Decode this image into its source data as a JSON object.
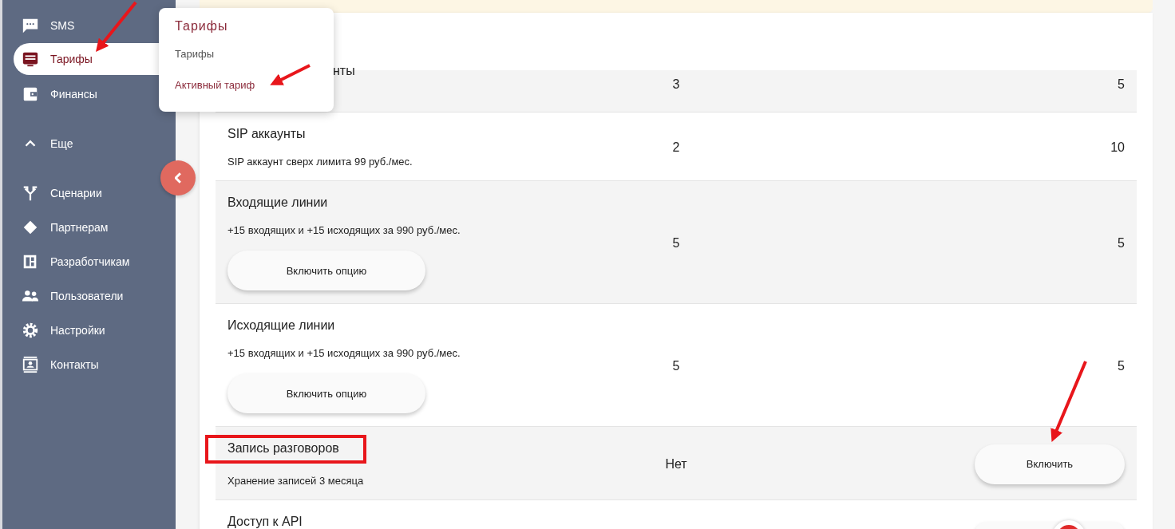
{
  "sidebar": {
    "items": [
      {
        "label": "SMS",
        "selected": false
      },
      {
        "label": "Тарифы",
        "selected": true
      },
      {
        "label": "Финансы",
        "selected": false
      },
      {
        "label": "Еще",
        "selected": false,
        "kind": "toggle"
      },
      {
        "label": "Сценарии",
        "selected": false
      },
      {
        "label": "Партнерам",
        "selected": false
      },
      {
        "label": "Разработчикам",
        "selected": false
      },
      {
        "label": "Пользователи",
        "selected": false
      },
      {
        "label": "Настройки",
        "selected": false
      },
      {
        "label": "Контакты",
        "selected": false
      }
    ]
  },
  "popup_menu": {
    "title": "Тарифы",
    "items": [
      {
        "label": "Тарифы",
        "selected": false
      },
      {
        "label": "Активный тариф",
        "selected": true
      }
    ]
  },
  "table": {
    "rows": [
      {
        "kind": "cut",
        "title": "нты",
        "column_2": "3",
        "column_3": "5"
      },
      {
        "title": "SIP аккаунты",
        "note": "SIP аккаунт сверх лимита 99 руб./мес.",
        "column_2": "2",
        "column_3": "10"
      },
      {
        "title": "Входящие линии",
        "note": "+15 входящих и +15 исходящих за 990 руб./мес.",
        "button": "Включить опцию",
        "column_2": "5",
        "column_3": "5"
      },
      {
        "title": "Исходящие линии",
        "note": "+15 входящих и +15 исходящих за 990 руб./мес.",
        "button": "Включить опцию",
        "column_2": "5",
        "column_3": "5"
      },
      {
        "title": "Запись разговоров",
        "highlighted": true,
        "note": "Хранение записей 3 месяца",
        "column_2": "Нет",
        "column_3_button": "Включить"
      },
      {
        "kind": "partial",
        "title": "Доступ к API"
      }
    ]
  }
}
